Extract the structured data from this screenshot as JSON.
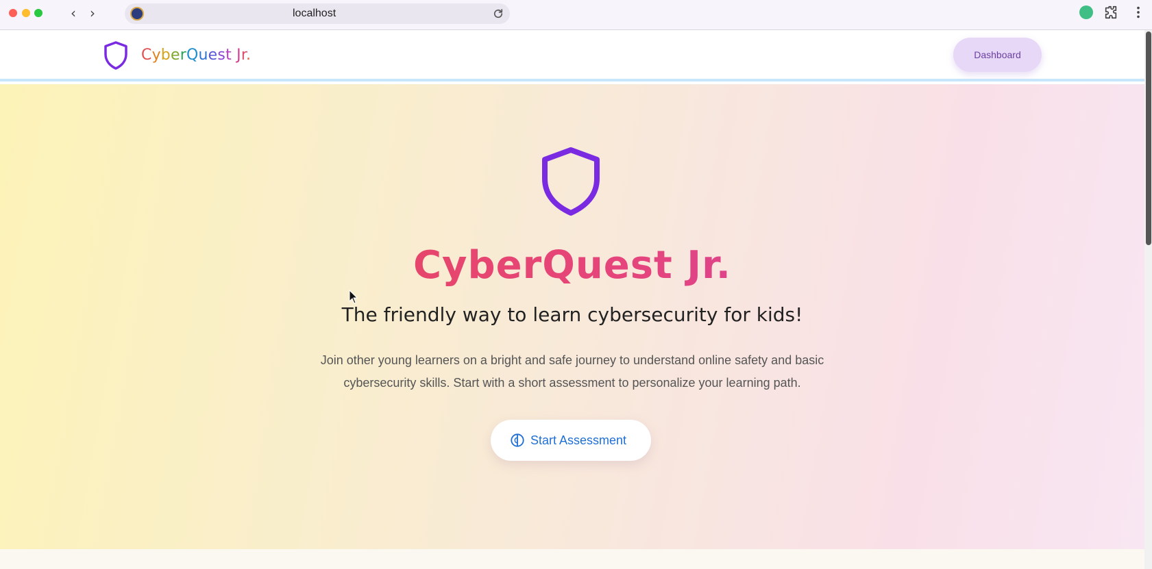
{
  "browser": {
    "url": "localhost"
  },
  "header": {
    "logo_letters": [
      "C",
      "y",
      "b",
      "e",
      "r",
      "Q",
      "u",
      "e",
      "s",
      "t",
      " ",
      "J",
      "r",
      "."
    ],
    "logo_colors": [
      "#e05050",
      "#e0821f",
      "#d5a317",
      "#7fa82a",
      "#2aa35a",
      "#1f8ec9",
      "#2d74d6",
      "#5a58d6",
      "#8a47d3",
      "#b43ec4",
      " ",
      "#d23f8e",
      "#de4c6a",
      "#e0603f"
    ],
    "dashboard_label": "Dashboard"
  },
  "hero": {
    "title": "CyberQuest Jr.",
    "subtitle": "The friendly way to learn cybersecurity for kids!",
    "description": "Join other young learners on a bright and safe journey to understand online safety and basic cybersecurity skills. Start with a short assessment to personalize your learning path.",
    "cta_label": "Start Assessment"
  },
  "colors": {
    "brand_purple": "#7a2be2",
    "cta_blue": "#1f6fd4",
    "title_red": "#e8474b",
    "title_pink": "#c63fbe"
  }
}
